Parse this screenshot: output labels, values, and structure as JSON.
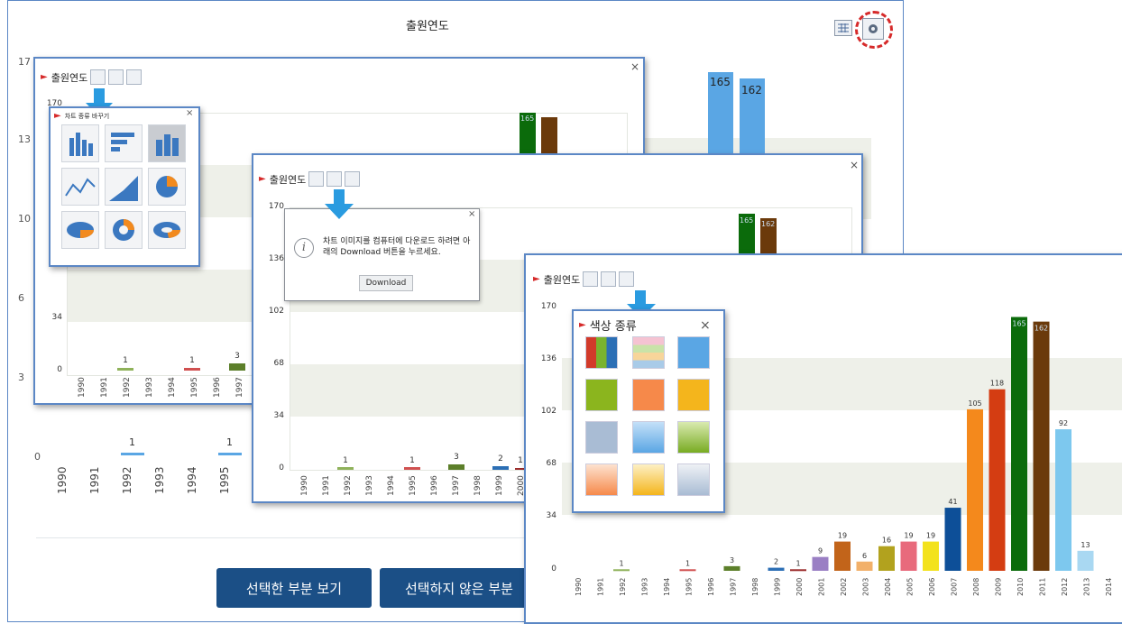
{
  "main": {
    "title": "출원연도",
    "y_ticks": [
      "17",
      "13",
      "10",
      "6",
      "3",
      "0"
    ],
    "x_ticks": [
      "1990",
      "1991",
      "1992",
      "1993",
      "1994",
      "1995"
    ],
    "bar_labels": [
      "1",
      "1"
    ],
    "big_labels": [
      "165",
      "162"
    ],
    "buttons": {
      "view_selected": "선택한 부분 보기",
      "view_unselected": "선택하지 않은 부분"
    }
  },
  "panel1": {
    "title": "출원연도",
    "y_ticks": [
      "170",
      "34",
      "0"
    ],
    "x_ticks": [
      "1990",
      "1991",
      "1992",
      "1993",
      "1994",
      "1995",
      "1996",
      "1997"
    ],
    "labels": [
      "1",
      "1",
      "3"
    ],
    "top_labels": [
      "165"
    ],
    "chart_type_popup": {
      "title": "차트 종류 바꾸기"
    }
  },
  "panel2": {
    "title": "출원연도",
    "y_ticks": [
      "170",
      "136",
      "102",
      "68",
      "34",
      "0"
    ],
    "x_ticks": [
      "1990",
      "1991",
      "1992",
      "1993",
      "1994",
      "1995",
      "1996",
      "1997",
      "1998",
      "1999",
      "2000"
    ],
    "labels": [
      "1",
      "1",
      "3",
      "2",
      "1"
    ],
    "top_labels": [
      "165",
      "162"
    ],
    "download_popup": {
      "message": "차트 이미지를 컴퓨터에 다운로드 하려면 아래의 Download 버튼을 누르세요.",
      "button": "Download"
    }
  },
  "panel3": {
    "title": "출원연도",
    "y_ticks": [
      "170",
      "136",
      "102",
      "68",
      "34",
      "0"
    ],
    "color_popup": {
      "title": "색상 종류"
    }
  },
  "colors": {
    "accent": "#5b87c5",
    "button_bg": "#1b4f86",
    "highlight_red": "#d62a2a",
    "arrow_blue": "#2a9be0"
  },
  "chart_data": {
    "type": "bar",
    "title": "출원연도",
    "categories": [
      "1990",
      "1991",
      "1992",
      "1993",
      "1994",
      "1995",
      "1996",
      "1997",
      "1998",
      "1999",
      "2000",
      "2001",
      "2002",
      "2003",
      "2004",
      "2005",
      "2006",
      "2007",
      "2008",
      "2009",
      "2010",
      "2011",
      "2012",
      "2013",
      "2014"
    ],
    "values": [
      0,
      0,
      1,
      0,
      0,
      1,
      0,
      3,
      0,
      2,
      1,
      9,
      19,
      6,
      16,
      19,
      19,
      41,
      105,
      118,
      165,
      162,
      92,
      13,
      0
    ],
    "bar_colors": [
      "#a6c98e",
      "#a6c98e",
      "#8fb25a",
      "#a6c98e",
      "#a6c98e",
      "#d05050",
      "#a6c98e",
      "#5c7f2a",
      "#a6c98e",
      "#2c6fb5",
      "#9b2c2c",
      "#9a7fc4",
      "#c2641a",
      "#f2b06a",
      "#b2a21e",
      "#e86a7c",
      "#f3e21c",
      "#0d4f98",
      "#f4891c",
      "#d43d12",
      "#0b6b0b",
      "#6b3a0b",
      "#7dc8ee",
      "#a9d8f2",
      "#a6c98e"
    ],
    "ylim": [
      0,
      170
    ],
    "yticks": [
      0,
      34,
      68,
      102,
      136,
      170
    ]
  }
}
